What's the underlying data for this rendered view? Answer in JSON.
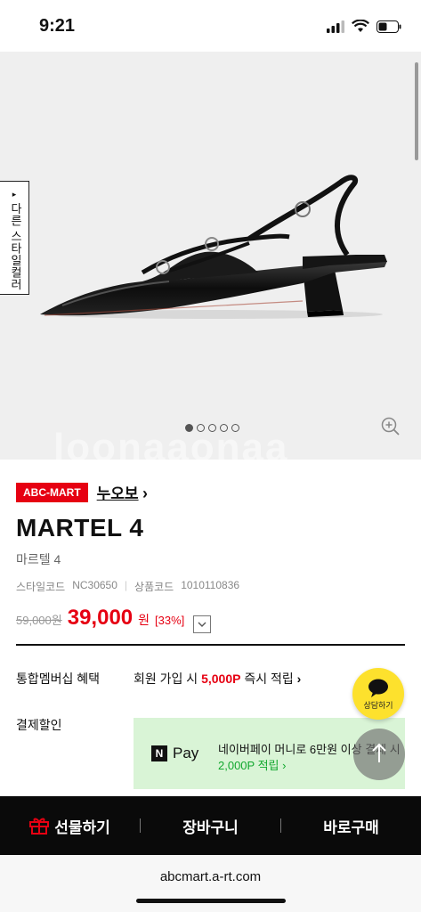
{
  "status": {
    "time": "9:21"
  },
  "hero": {
    "side_tab": "다른 스타일컬러",
    "slide_count": 5,
    "active_slide": 1,
    "watermark": "loonaaonaa"
  },
  "product": {
    "badge": "ABC-MART",
    "brand": "누오보",
    "brand_arrow": "›",
    "title": "MARTEL 4",
    "subtitle": "마르텔 4",
    "style_code_label": "스타일코드",
    "style_code": "NC30650",
    "product_code_label": "상품코드",
    "product_code": "1010110836",
    "original_price": "59,000원",
    "price": "39,000",
    "currency": "원",
    "discount": "[33%]"
  },
  "benefits": {
    "member_label": "통합멤버십 혜택",
    "member_prefix": "회원 가입 시",
    "member_points": "5,000P",
    "member_suffix": "즉시 적립",
    "member_arrow": "›",
    "payment_label": "결제할인",
    "npay_label": "Pay",
    "npay_line1": "네이버페이 머니로 6만원 이상 결제 시",
    "npay_line2": "2,000P 적립 ›"
  },
  "floating": {
    "chat_label": "상담하기"
  },
  "bottom_bar": {
    "gift": "선물하기",
    "cart": "장바구니",
    "buy": "바로구매"
  },
  "browser": {
    "url": "abcmart.a-rt.com"
  },
  "colors": {
    "accent": "#e60012",
    "npay_bg": "#d9f4d6",
    "chat": "#fde12d"
  }
}
